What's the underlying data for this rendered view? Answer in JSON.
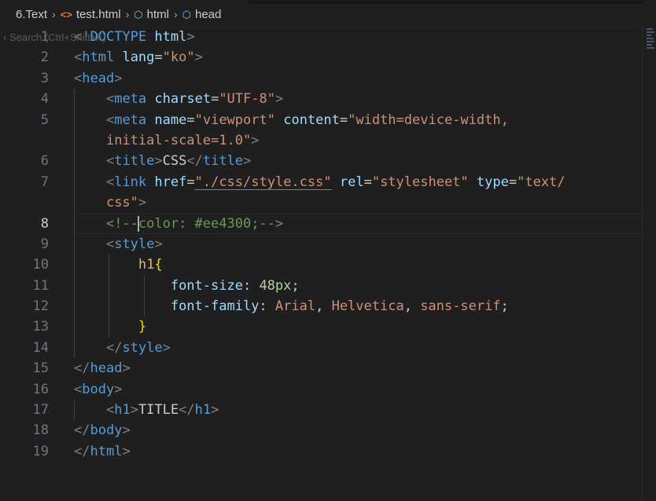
{
  "breadcrumb": {
    "folder": "6.Text",
    "file": "test.html",
    "element1": "html",
    "element2": "head",
    "file_icon": "html-file-icon",
    "element_icon": "symbol-element-icon"
  },
  "search_overlay": {
    "text": "Search (Ctrl+Shift+F)"
  },
  "editor": {
    "language": "html",
    "current_line": 8,
    "lines": [
      {
        "number": "1",
        "tokens": [
          {
            "cls": "t-punc",
            "text": "<!"
          },
          {
            "cls": "t-tag",
            "text": "DOCTYPE"
          },
          {
            "cls": "t-text",
            "text": " "
          },
          {
            "cls": "t-attr",
            "text": "html"
          },
          {
            "cls": "t-punc",
            "text": ">"
          }
        ]
      },
      {
        "number": "2",
        "tokens": [
          {
            "cls": "t-punc",
            "text": "<"
          },
          {
            "cls": "t-tag",
            "text": "html"
          },
          {
            "cls": "t-text",
            "text": " "
          },
          {
            "cls": "t-attr",
            "text": "lang"
          },
          {
            "cls": "t-text",
            "text": "="
          },
          {
            "cls": "t-str",
            "text": "\"ko\""
          },
          {
            "cls": "t-punc",
            "text": ">"
          }
        ]
      },
      {
        "number": "3",
        "tokens": [
          {
            "cls": "t-punc",
            "text": "<"
          },
          {
            "cls": "t-tag",
            "text": "head"
          },
          {
            "cls": "t-punc",
            "text": ">"
          }
        ]
      },
      {
        "number": "4",
        "indent": "    ",
        "tokens": [
          {
            "cls": "t-punc",
            "text": "<"
          },
          {
            "cls": "t-tag",
            "text": "meta"
          },
          {
            "cls": "t-text",
            "text": " "
          },
          {
            "cls": "t-attr",
            "text": "charset"
          },
          {
            "cls": "t-text",
            "text": "="
          },
          {
            "cls": "t-str",
            "text": "\"UTF-8\""
          },
          {
            "cls": "t-punc",
            "text": ">"
          }
        ]
      },
      {
        "number": "5",
        "indent": "    ",
        "tokens": [
          {
            "cls": "t-punc",
            "text": "<"
          },
          {
            "cls": "t-tag",
            "text": "meta"
          },
          {
            "cls": "t-text",
            "text": " "
          },
          {
            "cls": "t-attr",
            "text": "name"
          },
          {
            "cls": "t-text",
            "text": "="
          },
          {
            "cls": "t-str",
            "text": "\"viewport\""
          },
          {
            "cls": "t-text",
            "text": " "
          },
          {
            "cls": "t-attr",
            "text": "content"
          },
          {
            "cls": "t-text",
            "text": "="
          },
          {
            "cls": "t-str",
            "text": "\"width=device-width,"
          }
        ]
      },
      {
        "number": "",
        "indent": "    ",
        "tokens": [
          {
            "cls": "t-str",
            "text": "initial-scale=1.0\""
          },
          {
            "cls": "t-punc",
            "text": ">"
          }
        ]
      },
      {
        "number": "6",
        "indent": "    ",
        "tokens": [
          {
            "cls": "t-punc",
            "text": "<"
          },
          {
            "cls": "t-tag",
            "text": "title"
          },
          {
            "cls": "t-punc",
            "text": ">"
          },
          {
            "cls": "t-text",
            "text": "CSS"
          },
          {
            "cls": "t-punc",
            "text": "</"
          },
          {
            "cls": "t-tag",
            "text": "title"
          },
          {
            "cls": "t-punc",
            "text": ">"
          }
        ]
      },
      {
        "number": "7",
        "indent": "    ",
        "tokens": [
          {
            "cls": "t-punc",
            "text": "<"
          },
          {
            "cls": "t-tag",
            "text": "link"
          },
          {
            "cls": "t-text",
            "text": " "
          },
          {
            "cls": "t-attr",
            "text": "href"
          },
          {
            "cls": "t-text",
            "text": "="
          },
          {
            "cls": "t-str t-link",
            "text": "\"./css/style.css\""
          },
          {
            "cls": "t-text",
            "text": " "
          },
          {
            "cls": "t-attr",
            "text": "rel"
          },
          {
            "cls": "t-text",
            "text": "="
          },
          {
            "cls": "t-str",
            "text": "\"stylesheet\""
          },
          {
            "cls": "t-text",
            "text": " "
          },
          {
            "cls": "t-attr",
            "text": "type"
          },
          {
            "cls": "t-text",
            "text": "="
          },
          {
            "cls": "t-str",
            "text": "\"text/"
          }
        ]
      },
      {
        "number": "",
        "indent": "    ",
        "tokens": [
          {
            "cls": "t-str",
            "text": "css\""
          },
          {
            "cls": "t-punc",
            "text": ">"
          }
        ]
      },
      {
        "number": "8",
        "indent": "    ",
        "current": true,
        "tokens": [
          {
            "cls": "t-com",
            "text": "<!--"
          },
          {
            "cls": "cursor",
            "text": ""
          },
          {
            "cls": "t-com",
            "text": "color: #ee4300;-->"
          }
        ]
      },
      {
        "number": "9",
        "indent": "    ",
        "tokens": [
          {
            "cls": "t-punc",
            "text": "<"
          },
          {
            "cls": "t-tag",
            "text": "style"
          },
          {
            "cls": "t-punc",
            "text": ">"
          }
        ]
      },
      {
        "number": "10",
        "indent": "        ",
        "tokens": [
          {
            "cls": "t-sel",
            "text": "h1"
          },
          {
            "cls": "t-br",
            "text": "{"
          }
        ]
      },
      {
        "number": "11",
        "indent": "            ",
        "tokens": [
          {
            "cls": "t-prop",
            "text": "font-size"
          },
          {
            "cls": "t-text",
            "text": ": "
          },
          {
            "cls": "t-num",
            "text": "48px"
          },
          {
            "cls": "t-text",
            "text": ";"
          }
        ]
      },
      {
        "number": "12",
        "indent": "            ",
        "tokens": [
          {
            "cls": "t-prop",
            "text": "font-family"
          },
          {
            "cls": "t-text",
            "text": ": "
          },
          {
            "cls": "t-str",
            "text": "Arial"
          },
          {
            "cls": "t-text",
            "text": ", "
          },
          {
            "cls": "t-str",
            "text": "Helvetica"
          },
          {
            "cls": "t-text",
            "text": ", "
          },
          {
            "cls": "t-str",
            "text": "sans-serif"
          },
          {
            "cls": "t-text",
            "text": ";"
          }
        ]
      },
      {
        "number": "13",
        "indent": "        ",
        "tokens": [
          {
            "cls": "t-br",
            "text": "}"
          }
        ]
      },
      {
        "number": "14",
        "indent": "    ",
        "tokens": [
          {
            "cls": "t-punc",
            "text": "</"
          },
          {
            "cls": "t-tag",
            "text": "style"
          },
          {
            "cls": "t-punc",
            "text": ">"
          }
        ]
      },
      {
        "number": "15",
        "tokens": [
          {
            "cls": "t-punc",
            "text": "</"
          },
          {
            "cls": "t-tag",
            "text": "head"
          },
          {
            "cls": "t-punc",
            "text": ">"
          }
        ]
      },
      {
        "number": "16",
        "tokens": [
          {
            "cls": "t-punc",
            "text": "<"
          },
          {
            "cls": "t-tag",
            "text": "body"
          },
          {
            "cls": "t-punc",
            "text": ">"
          }
        ]
      },
      {
        "number": "17",
        "indent": "    ",
        "tokens": [
          {
            "cls": "t-punc",
            "text": "<"
          },
          {
            "cls": "t-tag",
            "text": "h1"
          },
          {
            "cls": "t-punc",
            "text": ">"
          },
          {
            "cls": "t-text",
            "text": "TITLE"
          },
          {
            "cls": "t-punc",
            "text": "</"
          },
          {
            "cls": "t-tag",
            "text": "h1"
          },
          {
            "cls": "t-punc",
            "text": ">"
          }
        ]
      },
      {
        "number": "18",
        "tokens": [
          {
            "cls": "t-punc",
            "text": "</"
          },
          {
            "cls": "t-tag",
            "text": "body"
          },
          {
            "cls": "t-punc",
            "text": ">"
          }
        ]
      },
      {
        "number": "19",
        "tokens": [
          {
            "cls": "t-punc",
            "text": "</"
          },
          {
            "cls": "t-tag",
            "text": "html"
          },
          {
            "cls": "t-punc",
            "text": ">"
          }
        ]
      }
    ]
  }
}
